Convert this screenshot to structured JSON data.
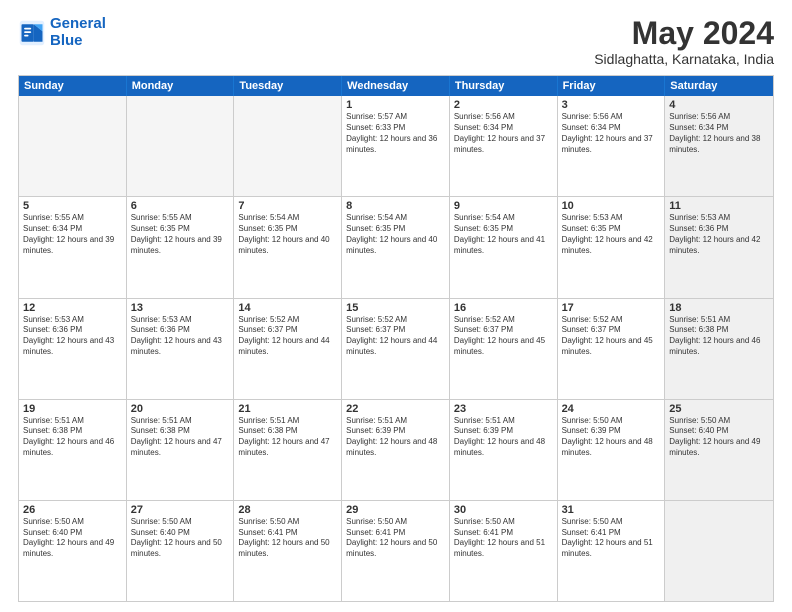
{
  "logo": {
    "line1": "General",
    "line2": "Blue"
  },
  "title": "May 2024",
  "subtitle": "Sidlaghatta, Karnataka, India",
  "days": [
    "Sunday",
    "Monday",
    "Tuesday",
    "Wednesday",
    "Thursday",
    "Friday",
    "Saturday"
  ],
  "rows": [
    [
      {
        "day": "",
        "empty": true
      },
      {
        "day": "",
        "empty": true
      },
      {
        "day": "",
        "empty": true
      },
      {
        "day": "1",
        "rise": "5:57 AM",
        "set": "6:33 PM",
        "light": "12 hours and 36 minutes."
      },
      {
        "day": "2",
        "rise": "5:56 AM",
        "set": "6:34 PM",
        "light": "12 hours and 37 minutes."
      },
      {
        "day": "3",
        "rise": "5:56 AM",
        "set": "6:34 PM",
        "light": "12 hours and 37 minutes."
      },
      {
        "day": "4",
        "rise": "5:56 AM",
        "set": "6:34 PM",
        "light": "12 hours and 38 minutes.",
        "shaded": true
      }
    ],
    [
      {
        "day": "5",
        "rise": "5:55 AM",
        "set": "6:34 PM",
        "light": "12 hours and 39 minutes."
      },
      {
        "day": "6",
        "rise": "5:55 AM",
        "set": "6:35 PM",
        "light": "12 hours and 39 minutes."
      },
      {
        "day": "7",
        "rise": "5:54 AM",
        "set": "6:35 PM",
        "light": "12 hours and 40 minutes."
      },
      {
        "day": "8",
        "rise": "5:54 AM",
        "set": "6:35 PM",
        "light": "12 hours and 40 minutes."
      },
      {
        "day": "9",
        "rise": "5:54 AM",
        "set": "6:35 PM",
        "light": "12 hours and 41 minutes."
      },
      {
        "day": "10",
        "rise": "5:53 AM",
        "set": "6:35 PM",
        "light": "12 hours and 42 minutes."
      },
      {
        "day": "11",
        "rise": "5:53 AM",
        "set": "6:36 PM",
        "light": "12 hours and 42 minutes.",
        "shaded": true
      }
    ],
    [
      {
        "day": "12",
        "rise": "5:53 AM",
        "set": "6:36 PM",
        "light": "12 hours and 43 minutes."
      },
      {
        "day": "13",
        "rise": "5:53 AM",
        "set": "6:36 PM",
        "light": "12 hours and 43 minutes."
      },
      {
        "day": "14",
        "rise": "5:52 AM",
        "set": "6:37 PM",
        "light": "12 hours and 44 minutes."
      },
      {
        "day": "15",
        "rise": "5:52 AM",
        "set": "6:37 PM",
        "light": "12 hours and 44 minutes."
      },
      {
        "day": "16",
        "rise": "5:52 AM",
        "set": "6:37 PM",
        "light": "12 hours and 45 minutes."
      },
      {
        "day": "17",
        "rise": "5:52 AM",
        "set": "6:37 PM",
        "light": "12 hours and 45 minutes."
      },
      {
        "day": "18",
        "rise": "5:51 AM",
        "set": "6:38 PM",
        "light": "12 hours and 46 minutes.",
        "shaded": true
      }
    ],
    [
      {
        "day": "19",
        "rise": "5:51 AM",
        "set": "6:38 PM",
        "light": "12 hours and 46 minutes."
      },
      {
        "day": "20",
        "rise": "5:51 AM",
        "set": "6:38 PM",
        "light": "12 hours and 47 minutes."
      },
      {
        "day": "21",
        "rise": "5:51 AM",
        "set": "6:38 PM",
        "light": "12 hours and 47 minutes."
      },
      {
        "day": "22",
        "rise": "5:51 AM",
        "set": "6:39 PM",
        "light": "12 hours and 48 minutes."
      },
      {
        "day": "23",
        "rise": "5:51 AM",
        "set": "6:39 PM",
        "light": "12 hours and 48 minutes."
      },
      {
        "day": "24",
        "rise": "5:50 AM",
        "set": "6:39 PM",
        "light": "12 hours and 48 minutes."
      },
      {
        "day": "25",
        "rise": "5:50 AM",
        "set": "6:40 PM",
        "light": "12 hours and 49 minutes.",
        "shaded": true
      }
    ],
    [
      {
        "day": "26",
        "rise": "5:50 AM",
        "set": "6:40 PM",
        "light": "12 hours and 49 minutes."
      },
      {
        "day": "27",
        "rise": "5:50 AM",
        "set": "6:40 PM",
        "light": "12 hours and 50 minutes."
      },
      {
        "day": "28",
        "rise": "5:50 AM",
        "set": "6:41 PM",
        "light": "12 hours and 50 minutes."
      },
      {
        "day": "29",
        "rise": "5:50 AM",
        "set": "6:41 PM",
        "light": "12 hours and 50 minutes."
      },
      {
        "day": "30",
        "rise": "5:50 AM",
        "set": "6:41 PM",
        "light": "12 hours and 51 minutes."
      },
      {
        "day": "31",
        "rise": "5:50 AM",
        "set": "6:41 PM",
        "light": "12 hours and 51 minutes."
      },
      {
        "day": "",
        "empty": true,
        "shaded": true
      }
    ]
  ]
}
